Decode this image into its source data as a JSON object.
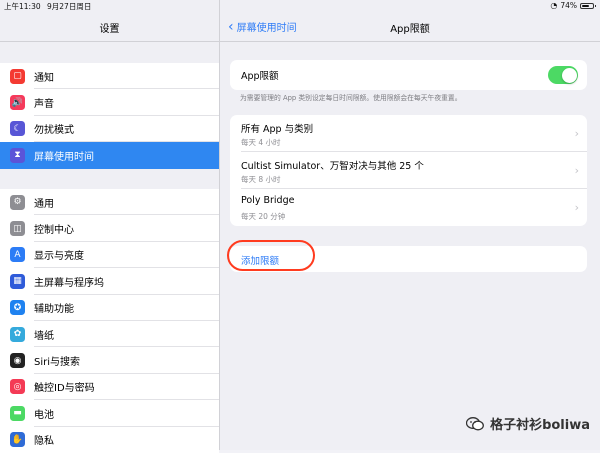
{
  "status_bar": {
    "time": "上午11:30",
    "date": "9月27日周日",
    "battery": "74%",
    "battery_level": 0.74
  },
  "left_pane": {
    "title": "设置",
    "group1": [
      {
        "label": "通知",
        "icon": "notifications-icon",
        "color": "#f43a32"
      },
      {
        "label": "声音",
        "icon": "sound-icon",
        "color": "#f53a5b"
      },
      {
        "label": "勿扰模式",
        "icon": "moon-icon",
        "color": "#5856d6"
      },
      {
        "label": "屏幕使用时间",
        "icon": "hourglass-icon",
        "color": "#5b54d8",
        "selected": true
      }
    ],
    "group2": [
      {
        "label": "通用",
        "icon": "gear-icon",
        "color": "#8e8e93"
      },
      {
        "label": "控制中心",
        "icon": "control-center-icon",
        "color": "#8e8e93"
      },
      {
        "label": "显示与亮度",
        "icon": "display-icon",
        "color": "#2c7cf6"
      },
      {
        "label": "主屏幕与程序坞",
        "icon": "home-screen-icon",
        "color": "#2f5bd9"
      },
      {
        "label": "辅助功能",
        "icon": "accessibility-icon",
        "color": "#1f82f0"
      },
      {
        "label": "墙纸",
        "icon": "wallpaper-icon",
        "color": "#35aadc"
      },
      {
        "label": "Siri与搜索",
        "icon": "siri-icon",
        "color": "#222"
      },
      {
        "label": "触控ID与密码",
        "icon": "fingerprint-icon",
        "color": "#f43a55"
      },
      {
        "label": "电池",
        "icon": "battery-icon",
        "color": "#4cd964"
      },
      {
        "label": "隐私",
        "icon": "hand-icon",
        "color": "#2f6bd6"
      }
    ]
  },
  "right_pane": {
    "back_label": "屏幕使用时间",
    "title": "App限额",
    "toggle_label": "App限额",
    "toggle_on": true,
    "note": "为需要管理的 App 类别设定每日时间限额。使用限额会在每天午夜重置。",
    "limits": [
      {
        "title": "所有 App 与类别",
        "subtitle": "每天 4 小时"
      },
      {
        "title": "Cultist Simulator、万智对决与其他 25 个",
        "subtitle": "每天 8 小时"
      },
      {
        "title": "Poly Bridge",
        "subtitle": "每天 20 分钟"
      }
    ],
    "add_label": "添加限额"
  },
  "watermark": {
    "text": "格子衬衫boliwa",
    "icon": "wechat-icon"
  },
  "colors": {
    "accent": "#2f7cf6",
    "selected": "#2f87f1",
    "switch_on": "#4cd964",
    "highlight_circle": "#ff3b1f"
  }
}
